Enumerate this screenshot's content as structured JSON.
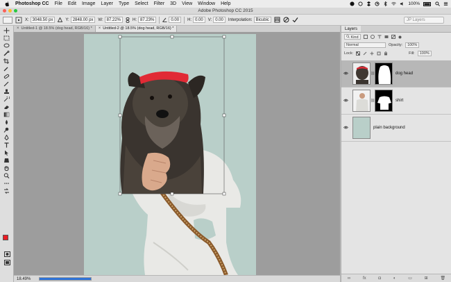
{
  "menubar": {
    "items": [
      "Photoshop CC",
      "File",
      "Edit",
      "Image",
      "Layer",
      "Type",
      "Select",
      "Filter",
      "3D",
      "View",
      "Window",
      "Help"
    ],
    "battery": "100%"
  },
  "window": {
    "title": "Adobe Photoshop CC 2015"
  },
  "options": {
    "x_label": "X:",
    "x_value": "3048.50 px",
    "y_label": "Y:",
    "y_value": "2848.00 px",
    "w_label": "W:",
    "w_value": "87.22%",
    "h_label": "H:",
    "h_value": "87.23%",
    "angle_value": "0.00",
    "hskew_label": "H:",
    "hskew_value": "0.00",
    "vskew_label": "V:",
    "vskew_value": "0.00",
    "interp_label": "Interpolation:",
    "interp_value": "Bicubic",
    "search_placeholder": "JP Layers"
  },
  "tabs": [
    {
      "label": "Untitled-1 @ 18.5% (dog head, RGB/16) *",
      "active": false
    },
    {
      "label": "Untitled-2 @ 18.5% (dog head, RGB/16) *",
      "active": true
    }
  ],
  "status": {
    "zoom": "18.49%",
    "progress": 1.0
  },
  "panel": {
    "tab": "Layers",
    "kind_label": "Kind",
    "blend_mode": "Normal",
    "opacity_label": "Opacity:",
    "opacity_value": "100%",
    "lock_label": "Lock:",
    "fill_label": "Fill:",
    "fill_value": "100%",
    "layers": [
      {
        "name": "dog head",
        "selected": true
      },
      {
        "name": "shirt",
        "selected": false
      },
      {
        "name": "plain background",
        "selected": false
      }
    ]
  },
  "colors": {
    "foreground": "#ec1c24",
    "background": "#ffffff",
    "canvas_bg": "#b9cfc9",
    "selected_layer": "#b7b7b7"
  }
}
